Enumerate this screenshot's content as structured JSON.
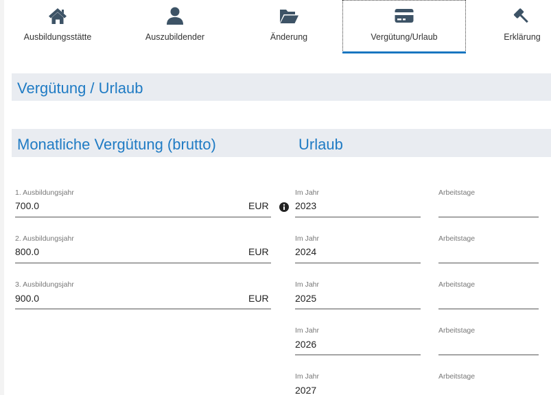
{
  "tabs": [
    {
      "label": "Ausbildungsstätte",
      "icon": "home-icon"
    },
    {
      "label": "Auszubildender",
      "icon": "user-icon"
    },
    {
      "label": "Änderung",
      "icon": "folder-open-icon"
    },
    {
      "label": "Vergütung/Urlaub",
      "icon": "credit-card-icon",
      "active": true
    },
    {
      "label": "Erklärung",
      "icon": "gavel-icon"
    }
  ],
  "section": {
    "title": "Vergütung / Urlaub"
  },
  "verguetung": {
    "title": "Monatliche Vergütung (brutto)",
    "unit": "EUR",
    "rows": [
      {
        "label": "1. Ausbildungsjahr",
        "value": "700.0"
      },
      {
        "label": "2. Ausbildungsjahr",
        "value": "800.0"
      },
      {
        "label": "3. Ausbildungsjahr",
        "value": "900.0"
      }
    ]
  },
  "urlaub": {
    "title": "Urlaub",
    "year_label": "Im Jahr",
    "days_label": "Arbeitstage",
    "rows": [
      {
        "year": "2023",
        "days": ""
      },
      {
        "year": "2024",
        "days": ""
      },
      {
        "year": "2025",
        "days": ""
      },
      {
        "year": "2026",
        "days": ""
      },
      {
        "year": "2027",
        "days": ""
      }
    ]
  },
  "colors": {
    "accent": "#1976c0",
    "title": "#1f7bc4",
    "bar": "#e9ecf1",
    "icon": "#3d5366"
  }
}
